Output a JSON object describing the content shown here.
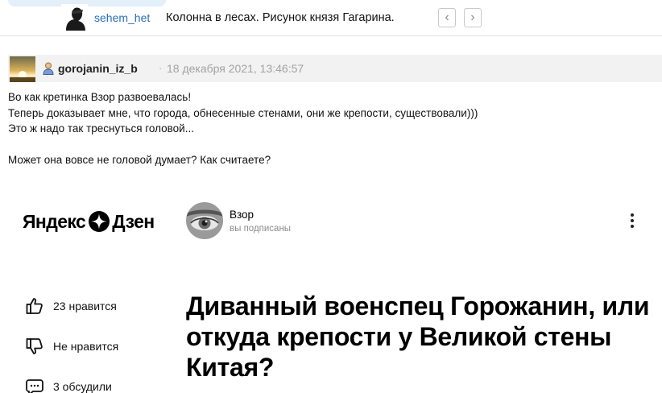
{
  "topbar": {
    "username": "sehem_het",
    "title": "Колонна в лесах. Рисунок князя Гагарина.",
    "prev_glyph": "‹",
    "next_glyph": "›"
  },
  "post": {
    "author": "gorojanin_iz_b",
    "separator": "·",
    "date": "18 декабря 2021, 13:46:57",
    "lines": [
      "Во как кретинка Взор развоевалась!",
      "Теперь доказывает мне, что города, обнесенные стенами, они же крепости, существовали)))",
      "Это ж надо так треснуться головой...",
      "",
      "Может она вовсе не головой думает? Как считаете?"
    ]
  },
  "embed": {
    "logo_left": "Яндекс",
    "logo_right": "Дзен",
    "channel_name": "Взор",
    "channel_subtitle": "вы подписаны",
    "likes": "23 нравится",
    "dislike": "Не нравится",
    "comments": "3 обсудили",
    "article_title": "Диванный военспец Горожанин, или откуда крепости у Великой стены Китая?"
  },
  "icons": [
    "avatar-silhouette-icon",
    "sunset-avatar",
    "user-icon",
    "zen-star-icon",
    "eye-avatar",
    "kebab-menu-icon",
    "thumbs-up-icon",
    "thumbs-down-icon",
    "comment-bubble-icon"
  ],
  "colors": {
    "link": "#2a6ebb",
    "date": "#a2a2a2",
    "header_bg": "#f2f2f2"
  }
}
